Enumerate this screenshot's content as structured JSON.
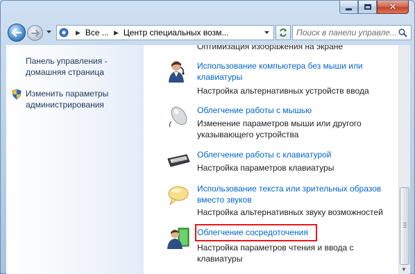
{
  "window": {
    "close_glyph": "✕"
  },
  "address_bar": {
    "crumbs": [
      "Все ...",
      "Центр специальных возм..."
    ]
  },
  "search": {
    "placeholder": "Поиск в панели управле..."
  },
  "sidebar": {
    "home_link": "Панель управления - домашняя страница",
    "admin_link": "Изменить параметры администрирования"
  },
  "main": {
    "partial_top": "Оптимизация изображения на экране",
    "items": [
      {
        "title": "Использование компьютера без мыши или клавиатуры",
        "desc": "Настройка альтернативных устройств ввода",
        "icon": "person-icon"
      },
      {
        "title": "Облегчение работы с мышью",
        "desc": "Изменение параметров мыши или другого указывающего устройства",
        "icon": "mouse-icon"
      },
      {
        "title": "Облегчение работы с клавиатурой",
        "desc": "Настройка параметров клавиатуры",
        "icon": "keyboard-icon"
      },
      {
        "title": "Использование текста или зрительных образов вместо звуков",
        "desc": "Настройка альтернативных звуку возможностей",
        "icon": "speech-bubble-icon"
      },
      {
        "title": "Облегчение сосредоточения",
        "desc": "Настройка параметров чтения и ввода с клавиатуры",
        "icon": "person-book-icon"
      }
    ]
  },
  "colors": {
    "link": "#0066cc",
    "highlight_border": "#e8141b"
  }
}
